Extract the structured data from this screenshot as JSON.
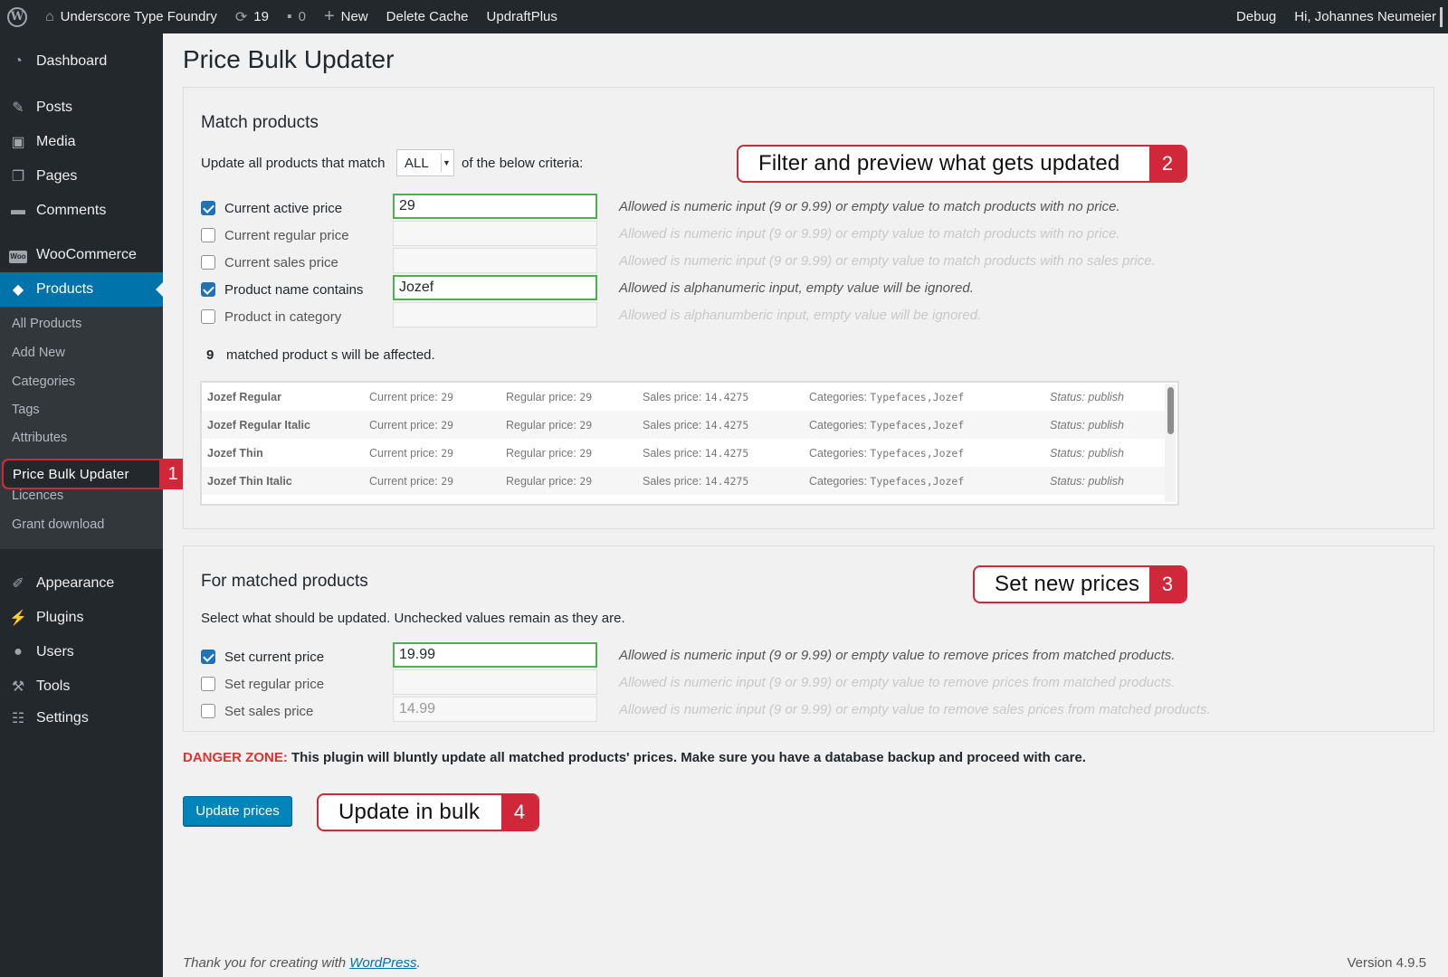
{
  "adminbar": {
    "site_name": "Underscore Type Foundry",
    "updates_count": "19",
    "comments_count": "0",
    "new_label": "New",
    "delete_cache": "Delete Cache",
    "updraft": "UpdraftPlus",
    "debug": "Debug",
    "greeting": "Hi, Johannes Neumeier"
  },
  "sidebar": {
    "dashboard": "Dashboard",
    "posts": "Posts",
    "media": "Media",
    "pages": "Pages",
    "comments": "Comments",
    "woocommerce": "WooCommerce",
    "woo_badge": "Woo",
    "products": "Products",
    "submenu": [
      "All Products",
      "Add New",
      "Categories",
      "Tags",
      "Attributes",
      "Price Bulk Updater",
      "Licences",
      "Grant download"
    ],
    "appearance": "Appearance",
    "plugins": "Plugins",
    "users": "Users",
    "tools": "Tools",
    "settings": "Settings"
  },
  "page": {
    "title": "Price Bulk Updater"
  },
  "match": {
    "title": "Match products",
    "intro_before": "Update all products that match",
    "select_value": "ALL",
    "intro_after": "of the below criteria:",
    "criteria": [
      {
        "label": "Current active price",
        "checked": true,
        "value": "29",
        "help": "Allowed is numeric input (9 or 9.99) or empty value to match products with no price."
      },
      {
        "label": "Current regular price",
        "checked": false,
        "value": "",
        "help": "Allowed is numeric input (9 or 9.99) or empty value to match products with no price."
      },
      {
        "label": "Current sales price",
        "checked": false,
        "value": "",
        "help": "Allowed is numeric input (9 or 9.99) or empty value to match products with no sales price."
      },
      {
        "label": "Product name contains",
        "checked": true,
        "value": "Jozef",
        "help": "Allowed is alphanumeric input, empty value will be ignored."
      },
      {
        "label": "Product in category",
        "checked": false,
        "value": "",
        "help": "Allowed is alphanumberic input, empty value will be ignored."
      }
    ],
    "matched_count": "9",
    "matched_text": "matched product s will be affected.",
    "rows": [
      {
        "name": "Jozef Regular",
        "current_label": "Current price:",
        "current": "29",
        "regular_label": "Regular price:",
        "regular": "29",
        "sales_label": "Sales price:",
        "sales": "14.4275",
        "cat_label": "Categories:",
        "cats": "Typefaces,Jozef",
        "status": "Status: publish"
      },
      {
        "name": "Jozef Regular Italic",
        "current_label": "Current price:",
        "current": "29",
        "regular_label": "Regular price:",
        "regular": "29",
        "sales_label": "Sales price:",
        "sales": "14.4275",
        "cat_label": "Categories:",
        "cats": "Typefaces,Jozef",
        "status": "Status: publish"
      },
      {
        "name": "Jozef Thin",
        "current_label": "Current price:",
        "current": "29",
        "regular_label": "Regular price:",
        "regular": "29",
        "sales_label": "Sales price:",
        "sales": "14.4275",
        "cat_label": "Categories:",
        "cats": "Typefaces,Jozef",
        "status": "Status: publish"
      },
      {
        "name": "Jozef Thin Italic",
        "current_label": "Current price:",
        "current": "29",
        "regular_label": "Regular price:",
        "regular": "29",
        "sales_label": "Sales price:",
        "sales": "14.4275",
        "cat_label": "Categories:",
        "cats": "Typefaces,Jozef",
        "status": "Status: publish"
      }
    ]
  },
  "update": {
    "title": "For matched products",
    "intro": "Select what should be updated. Unchecked values remain as they are.",
    "fields": [
      {
        "label": "Set current price",
        "checked": true,
        "value": "19.99",
        "help": "Allowed is numeric input (9 or 9.99) or empty value to remove prices from matched products."
      },
      {
        "label": "Set regular price",
        "checked": false,
        "value": "",
        "help": "Allowed is numeric input (9 or 9.99) or empty value to remove prices from matched products."
      },
      {
        "label": "Set sales price",
        "checked": false,
        "value": "14.99",
        "help": "Allowed is numeric input (9 or 9.99) or empty value to remove sales prices from matched products."
      }
    ]
  },
  "danger": {
    "label": "DANGER ZONE:",
    "text": "This plugin will bluntly update all matched products' prices. Make sure you have a database backup and proceed with care."
  },
  "button": {
    "label": "Update prices"
  },
  "callouts": [
    {
      "text": "Filter and preview what gets updated",
      "num": "2"
    },
    {
      "text": "Set new prices",
      "num": "3"
    },
    {
      "text": "Update in bulk",
      "num": "4"
    },
    {
      "num": "1"
    }
  ],
  "footer": {
    "thanks_before": "Thank you for creating with",
    "wordpress": "WordPress",
    "thanks_after": ".",
    "version": "Version 4.9.5"
  },
  "colors": {
    "accent": "#0073aa",
    "callout": "#d0283a",
    "danger": "#dc3232",
    "valid_border": "#4caf50"
  }
}
